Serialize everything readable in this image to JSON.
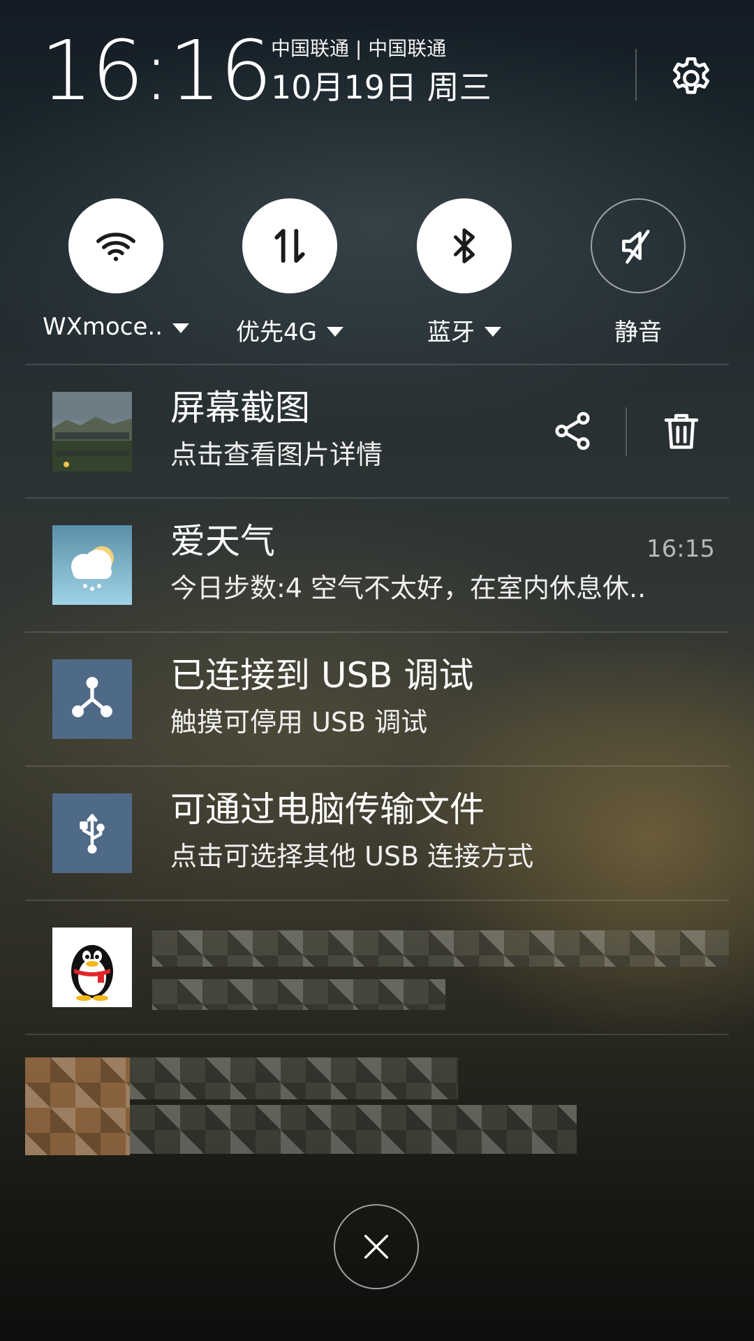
{
  "header": {
    "time": "16:16",
    "carrier": "中国联通 | 中国联通",
    "date": "10月19日 周三",
    "settings_icon": "gear-icon"
  },
  "toggles": [
    {
      "label": "WXmoce..",
      "icon": "wifi-icon",
      "state": "on",
      "has_dropdown": true
    },
    {
      "label": "优先4G",
      "icon": "mobile-data-icon",
      "state": "on",
      "has_dropdown": true
    },
    {
      "label": "蓝牙",
      "icon": "bluetooth-icon",
      "state": "on",
      "has_dropdown": true
    },
    {
      "label": "静音",
      "icon": "mute-icon",
      "state": "off",
      "has_dropdown": false
    }
  ],
  "notifications": [
    {
      "title": "屏幕截图",
      "subtitle": "点击查看图片详情",
      "time": "",
      "icon": "screenshot-thumbnail",
      "actions": [
        "share-icon",
        "trash-icon"
      ]
    },
    {
      "title": "爱天气",
      "subtitle": "今日步数:4 空气不太好，在室内休息休..",
      "time": "16:15",
      "icon": "weather-cloud-icon"
    },
    {
      "title": "已连接到 USB 调试",
      "subtitle": "触摸可停用 USB 调试",
      "time": "",
      "icon": "usb-debug-icon"
    },
    {
      "title": "可通过电脑传输文件",
      "subtitle": "点击可选择其他 USB 连接方式",
      "time": "",
      "icon": "usb-icon"
    },
    {
      "title": "",
      "subtitle": "",
      "time": "",
      "icon": "qq-penguin-icon",
      "content": "pixelated"
    },
    {
      "title": "",
      "subtitle": "",
      "time": "",
      "icon": "",
      "content": "pixelated"
    }
  ],
  "footer": {
    "close_icon": "close-icon"
  },
  "colors": {
    "usb_icon_bg": "#4f6a87",
    "toggle_on": "#ffffff",
    "divider": "rgba(255,255,255,0.14)"
  }
}
